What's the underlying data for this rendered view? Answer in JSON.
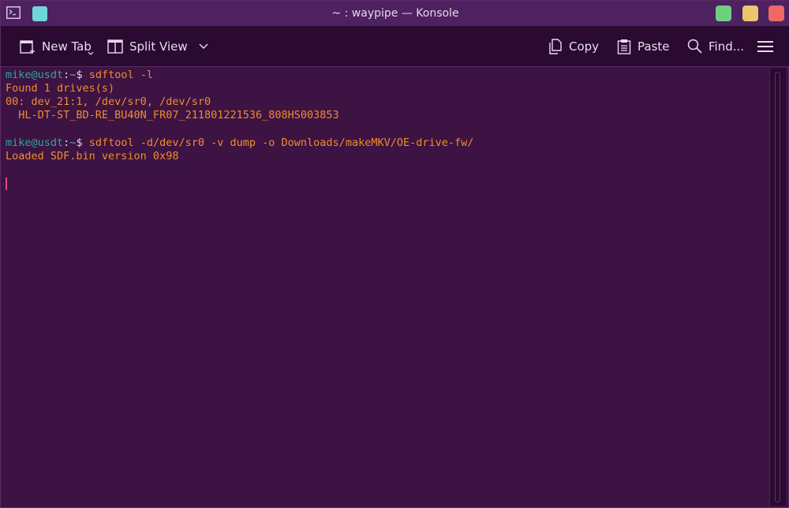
{
  "window": {
    "title": "~ : waypipe — Konsole",
    "icons": [
      "terminal-app-icon",
      "pin-icon",
      "minimize-icon",
      "maximize-icon",
      "close-icon"
    ],
    "colors": {
      "titlebar": "#4e2160",
      "toolbar": "#2a0a31",
      "terminal_bg": "#3c1343",
      "minimize": "#6fcf7f",
      "maximize": "#e8c86a",
      "close": "#ef6767"
    }
  },
  "toolbar": {
    "new_tab": "New Tab",
    "split_view": "Split View",
    "copy": "Copy",
    "paste": "Paste",
    "find": "Find..."
  },
  "terminal": {
    "colors": {
      "output": "#f08c2e",
      "user": "#2ea89a",
      "path": "#55a8d8"
    },
    "cmd1": {
      "user": "mike@usdt",
      "path": "~",
      "sym": "$",
      "command": " sdftool -l"
    },
    "out1": "Found 1 drives(s)",
    "out2": "00: dev_21:1, /dev/sr0, /dev/sr0",
    "out3": "  HL-DT-ST_BD-RE_BU40N_FR07_211801221536_808HS003853",
    "cmd2": {
      "user": "mike@usdt",
      "path": "~",
      "sym": "$",
      "command": " sdftool -d/dev/sr0 -v dump -o Downloads/makeMKV/OE-drive-fw/"
    },
    "out4": "Loaded SDF.bin version 0x98"
  }
}
